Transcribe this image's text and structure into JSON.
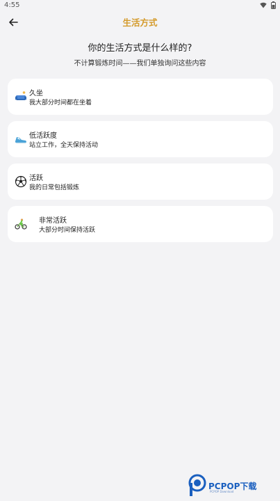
{
  "status_bar": {
    "time": "4:55"
  },
  "app_bar": {
    "title": "生活方式"
  },
  "question": "你的生活方式是什么样的?",
  "subtitle": "不计算锻炼时间——我们单独询问这些内容",
  "options": [
    {
      "title": "久坐",
      "desc": "我大部分时间都在坐着",
      "icon": "sofa-icon"
    },
    {
      "title": "低活跃度",
      "desc": "站立工作，全天保持活动",
      "icon": "sneaker-icon"
    },
    {
      "title": "活跃",
      "desc": "我的日常包括锻炼",
      "icon": "soccer-ball-icon"
    },
    {
      "title": "非常活跃",
      "desc": "大部分时间保持活跃",
      "icon": "cyclist-icon"
    }
  ],
  "watermark": {
    "brand": "PCPOP下载",
    "sub": "PCPOP Download"
  },
  "colors": {
    "title_accent": "#d49a2a",
    "background": "#f3f3f5",
    "card": "#ffffff"
  }
}
